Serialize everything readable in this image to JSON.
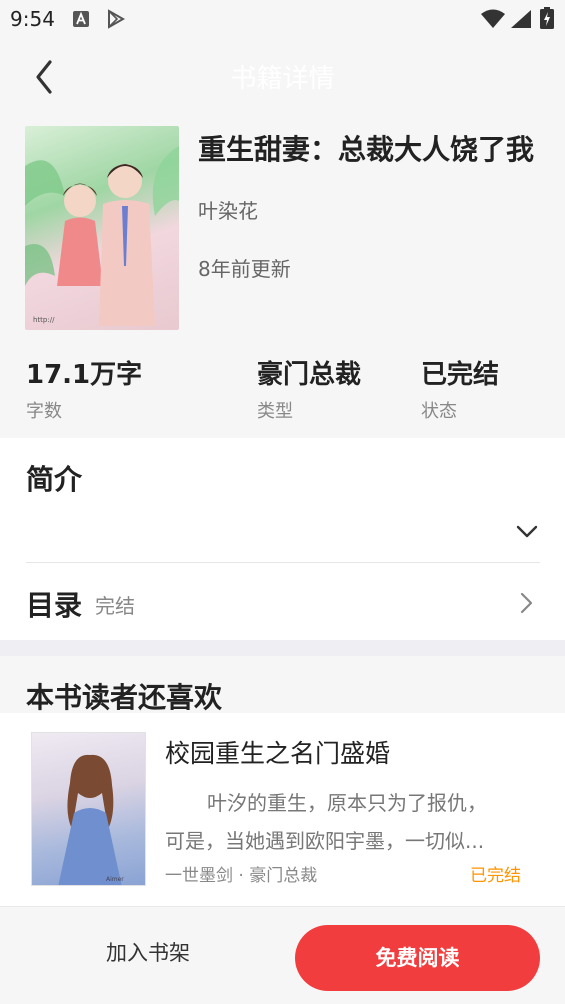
{
  "status_bar": {
    "time": "9:54",
    "icons": [
      "a-notification-icon",
      "play-store-icon",
      "wifi-icon",
      "signal-icon",
      "battery-icon"
    ]
  },
  "top_bar": {
    "title": "书籍详情",
    "back_icon": "back-arrow-icon"
  },
  "book": {
    "title": "重生甜妻：总裁大人饶了我",
    "author": "叶染花",
    "updated": "8年前更新"
  },
  "stats": [
    {
      "value": "17.1万字",
      "label": "字数"
    },
    {
      "value": "豪门总裁",
      "label": "类型"
    },
    {
      "value": "已完结",
      "label": "状态"
    }
  ],
  "intro": {
    "title": "简介",
    "toggle_icon": "chevron-down-icon"
  },
  "toc": {
    "title": "目录",
    "status": "完结",
    "arrow_icon": "chevron-right-icon"
  },
  "recommend": {
    "title": "本书读者还喜欢",
    "items": [
      {
        "name": "校园重生之名门盛婚",
        "desc_line1": "叶汐的重生，原本只为了报仇，",
        "desc_line2": "可是，当她遇到欧阳宇墨，一切似...",
        "meta": "一世墨剑 · 豪门总裁",
        "status": "已完结"
      }
    ]
  },
  "bottom_bar": {
    "add_shelf": "加入书架",
    "read_free": "免费阅读"
  },
  "colors": {
    "accent_red": "#f23d3f",
    "status_orange": "#ff9500",
    "background_gray": "#f6f6f6"
  }
}
